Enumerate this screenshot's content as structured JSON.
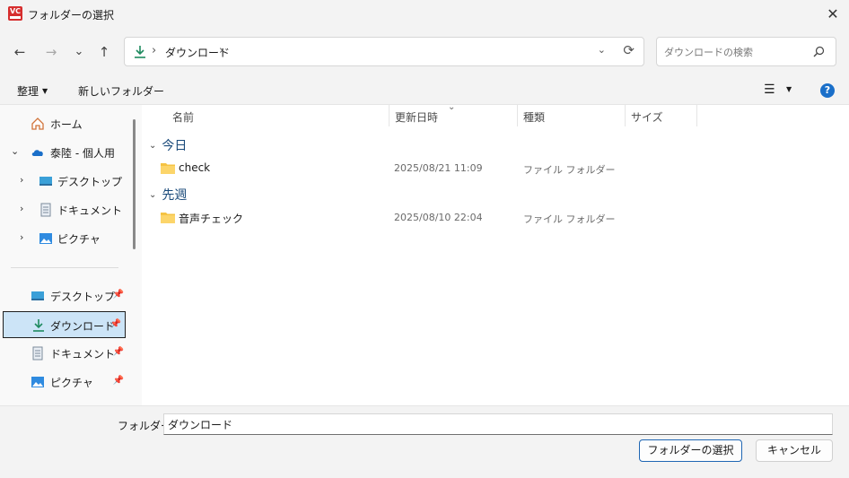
{
  "window": {
    "title": "フォルダーの選択",
    "app_icon_text": "VC",
    "close": "✕"
  },
  "nav": {
    "back": "←",
    "forward": "→",
    "recent": "⌄",
    "up": "↑"
  },
  "address": {
    "chevron": "›",
    "path": "ダウンロード",
    "path_chevron": "›",
    "dropdown": "⌄",
    "refresh": "⟳"
  },
  "search": {
    "placeholder": "ダウンロードの検索"
  },
  "toolbar": {
    "organize": "整理",
    "organize_caret": "▼",
    "new_folder": "新しいフォルダー",
    "view": "☰",
    "view_caret": "▼",
    "help": "?"
  },
  "sidebar": {
    "home": "ホーム",
    "onedrive": "泰陸 - 個人用",
    "tree": [
      {
        "chevron": "›",
        "label": "デスクトップ"
      },
      {
        "chevron": "›",
        "label": "ドキュメント"
      },
      {
        "chevron": "›",
        "label": "ピクチャ"
      }
    ],
    "onedrive_chevron": "⌄",
    "quick": [
      {
        "label": "デスクトップ",
        "pin": "📌"
      },
      {
        "label": "ダウンロード",
        "pin": "📌"
      },
      {
        "label": "ドキュメント",
        "pin": "📌"
      },
      {
        "label": "ピクチャ",
        "pin": "📌"
      }
    ]
  },
  "columns": {
    "name": "名前",
    "modified": "更新日時",
    "type": "種類",
    "size": "サイズ",
    "sort_indicator": "⌄"
  },
  "groups": [
    {
      "chevron": "⌄",
      "label": "今日",
      "rows": [
        {
          "name": "check",
          "date": "2025/08/21 11:09",
          "type": "ファイル フォルダー"
        }
      ]
    },
    {
      "chevron": "⌄",
      "label": "先週",
      "rows": [
        {
          "name": "音声チェック",
          "date": "2025/08/10 22:04",
          "type": "ファイル フォルダー"
        }
      ]
    }
  ],
  "bottom": {
    "folder_label": "フォルダー:",
    "folder_value": "ダウンロード",
    "select_button": "フォルダーの選択",
    "cancel_button": "キャンセル"
  },
  "colors": {
    "accent": "#1a6fc9",
    "selection": "#cce4f7",
    "download_green": "#1e8a5f",
    "folder_yellow": "#f5c343"
  }
}
